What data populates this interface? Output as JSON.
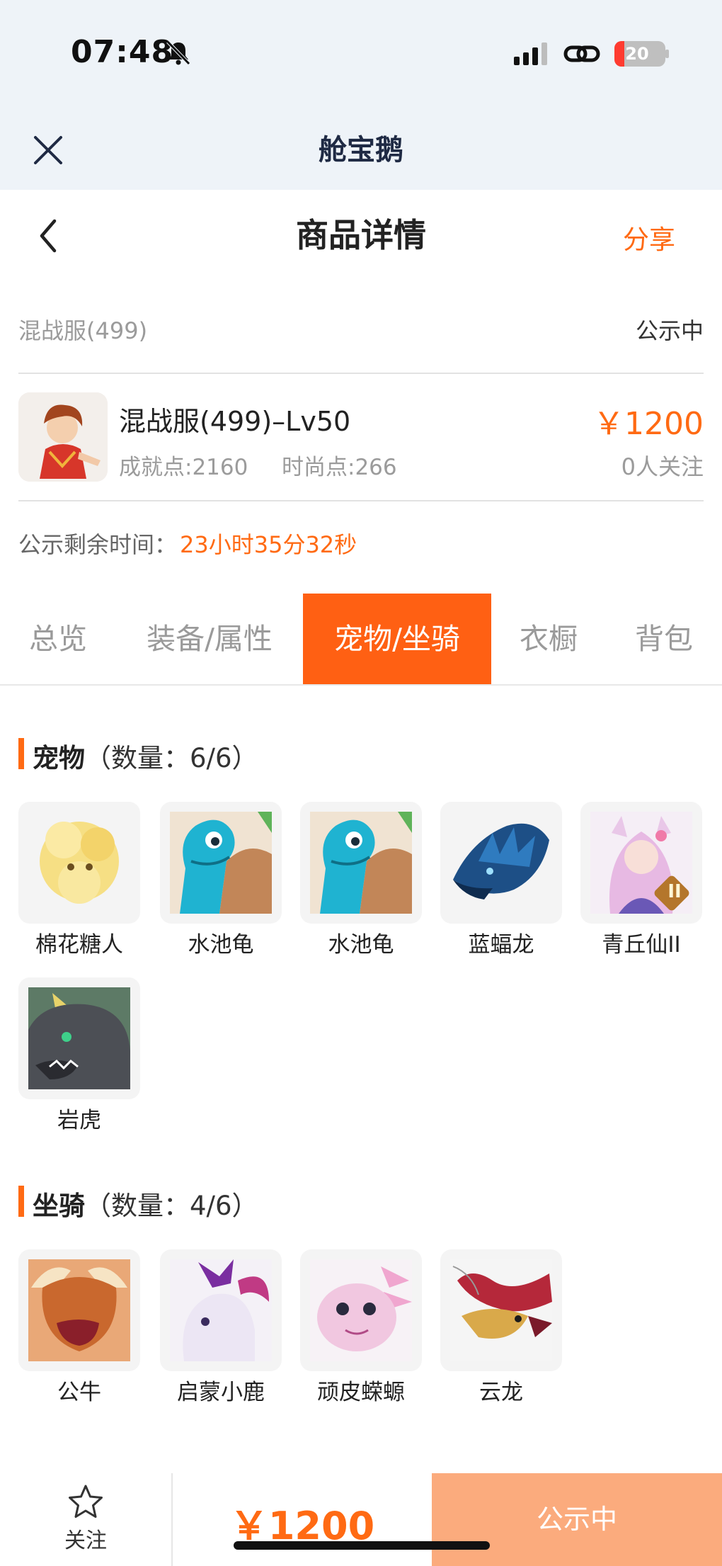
{
  "status_bar": {
    "time": "07:48",
    "battery": "20",
    "battery_level": 0.2,
    "icons": [
      "mute-bell-icon",
      "cellular-signal-icon",
      "link-icon",
      "battery-charging-icon"
    ]
  },
  "mini_header": {
    "title": "舱宝鹅",
    "close_icon": "close-icon"
  },
  "header": {
    "title": "商品详情",
    "share": "分享",
    "back_icon": "chevron-left-icon"
  },
  "listing": {
    "server": "混战服(499)",
    "status": "公示中",
    "title": "混战服(499)–Lv50",
    "achievement": "成就点:2160",
    "fashion": "时尚点:266",
    "price": "￥1200",
    "watchers": "0人关注",
    "countdown_label": "公示剩余时间：",
    "countdown_value": "23小时35分32秒"
  },
  "tabs": [
    {
      "label": "总览",
      "active": false
    },
    {
      "label": "装备/属性",
      "active": false
    },
    {
      "label": "宠物/坐骑",
      "active": true
    },
    {
      "label": "衣橱",
      "active": false
    },
    {
      "label": "背包",
      "active": false
    }
  ],
  "pets": {
    "title": "宠物",
    "count": "（数量：6/6）",
    "items": [
      {
        "name": "棉花糖人"
      },
      {
        "name": "水池龟"
      },
      {
        "name": "水池龟"
      },
      {
        "name": "蓝蝠龙"
      },
      {
        "name": "青丘仙II",
        "badge": "II"
      },
      {
        "name": "岩虎"
      }
    ]
  },
  "mounts": {
    "title": "坐骑",
    "count": "（数量：4/6）",
    "items": [
      {
        "name": "公牛"
      },
      {
        "name": "启蒙小鹿"
      },
      {
        "name": "顽皮蝾螈"
      },
      {
        "name": "云龙"
      }
    ]
  },
  "bottom_bar": {
    "follow": "关注",
    "price": "￥1200",
    "action": "公示中"
  },
  "colors": {
    "accent": "#ff6a13",
    "tab_active": "#ff6013",
    "action_button": "#fbab7d"
  }
}
